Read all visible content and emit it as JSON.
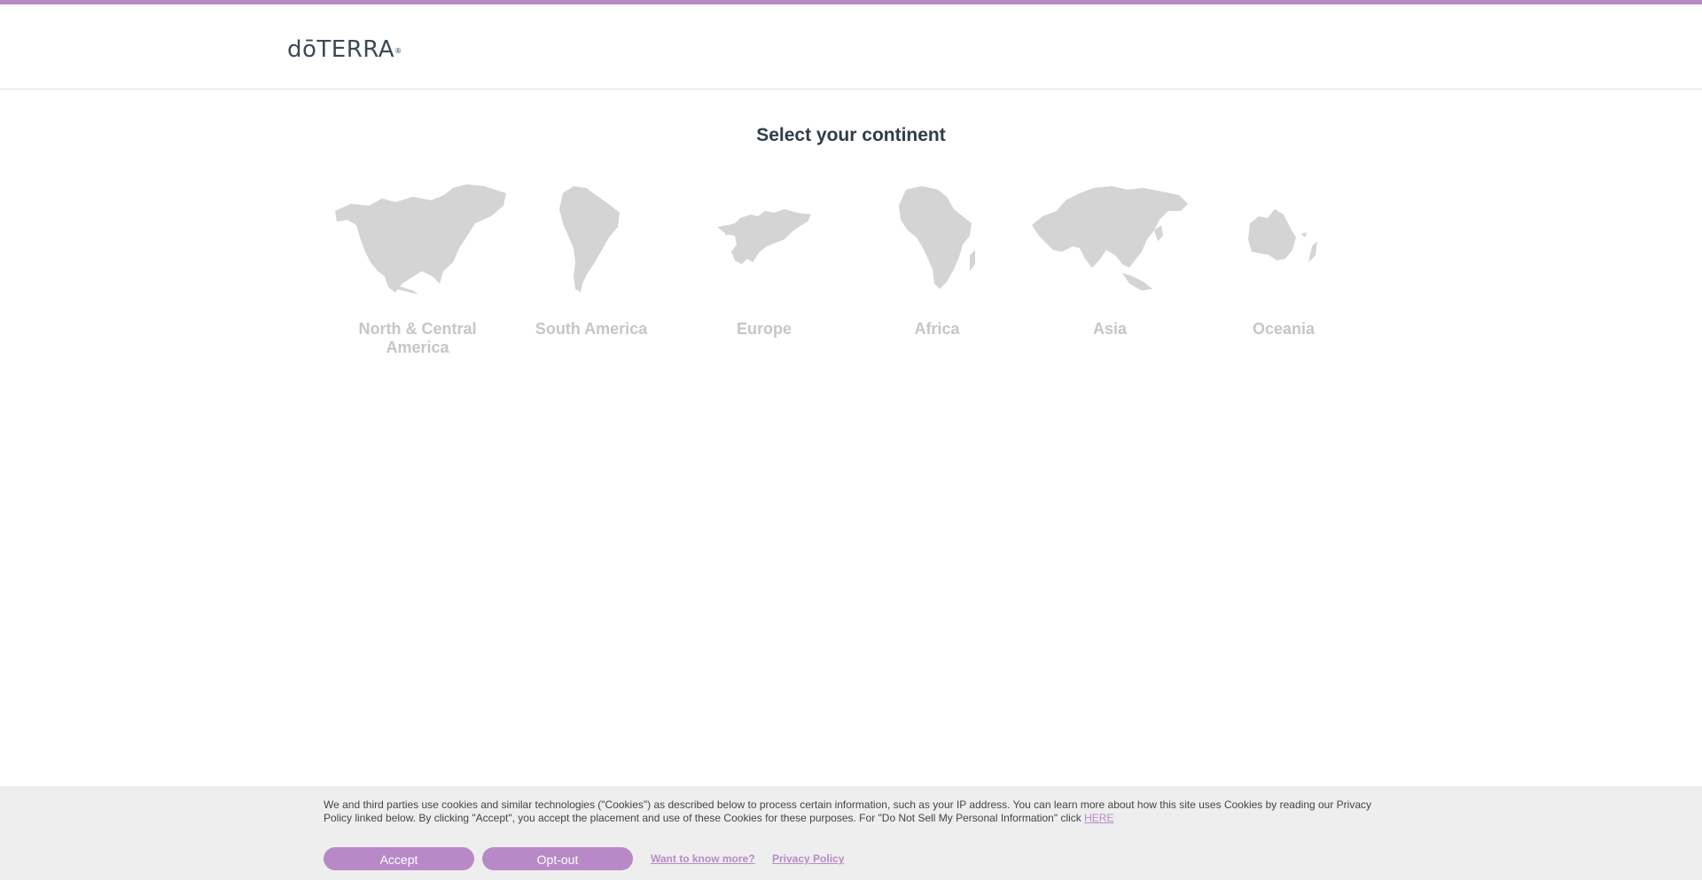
{
  "header": {
    "logo_text": "dōTERRA",
    "logo_mark": "®"
  },
  "page": {
    "title": "Select your continent"
  },
  "continents": [
    {
      "label": "North & Central America",
      "icon": "north-america-map-icon"
    },
    {
      "label": "South America",
      "icon": "south-america-map-icon"
    },
    {
      "label": "Europe",
      "icon": "europe-map-icon"
    },
    {
      "label": "Africa",
      "icon": "africa-map-icon"
    },
    {
      "label": "Asia",
      "icon": "asia-map-icon"
    },
    {
      "label": "Oceania",
      "icon": "oceania-map-icon"
    }
  ],
  "cookie_banner": {
    "text": "We and third parties use cookies and similar technologies (\"Cookies\") as described below to process certain information, such as your IP address. You can learn more about how this site uses Cookies by reading our Privacy Policy linked below. By clicking \"Accept\", you accept the placement and use of these Cookies for these purposes. For \"Do Not Sell My Personal Information\" click",
    "here_link": "HERE",
    "accept_label": "Accept",
    "optout_label": "Opt-out",
    "more_link": "Want to know more?",
    "privacy_link": "Privacy Policy"
  },
  "colors": {
    "accent": "#b889c7",
    "map_gray": "#d4d4d4",
    "label_gray": "#c6c6c6",
    "title": "#2f3d49"
  }
}
